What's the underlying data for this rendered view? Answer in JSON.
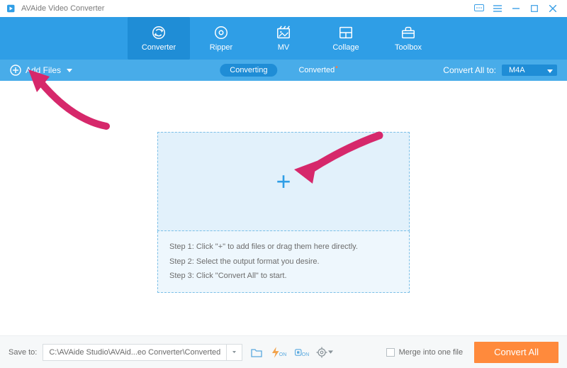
{
  "title": "AVAide Video Converter",
  "toolbar": {
    "converter": "Converter",
    "ripper": "Ripper",
    "mv": "MV",
    "collage": "Collage",
    "toolbox": "Toolbox"
  },
  "subbar": {
    "add_files": "Add Files",
    "tab_converting": "Converting",
    "tab_converted": "Converted",
    "convert_all_to_label": "Convert All to:",
    "convert_all_to_value": "M4A"
  },
  "drop": {
    "plus": "+",
    "step1": "Step 1: Click \"+\" to add files or drag them here directly.",
    "step2": "Step 2: Select the output format you desire.",
    "step3": "Step 3: Click \"Convert All\" to start."
  },
  "bottom": {
    "save_to_label": "Save to:",
    "save_path": "C:\\AVAide Studio\\AVAid...eo Converter\\Converted",
    "merge_label": "Merge into one file",
    "convert_all": "Convert All"
  }
}
